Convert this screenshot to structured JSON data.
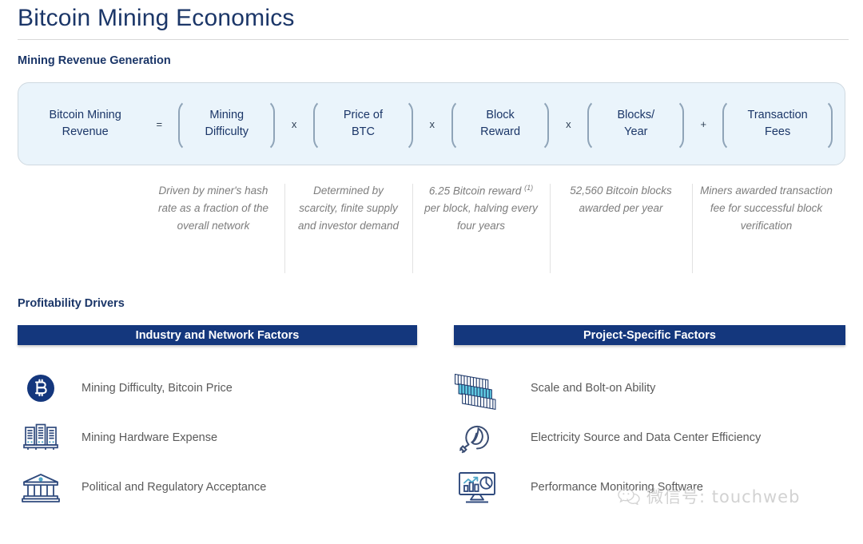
{
  "header": {
    "title": "Bitcoin Mining Economics"
  },
  "sections": {
    "revenue_label": "Mining Revenue Generation",
    "profitability_label": "Profitability Drivers"
  },
  "formula": {
    "result": "Bitcoin Mining\nRevenue",
    "equals": "=",
    "terms": [
      {
        "label": "Mining\nDifficulty",
        "operator_after": "x"
      },
      {
        "label": "Price of\nBTC",
        "operator_after": "x"
      },
      {
        "label": "Block\nReward",
        "operator_after": "x"
      },
      {
        "label": "Blocks/\nYear",
        "operator_after": "+"
      },
      {
        "label": "Transaction\nFees",
        "operator_after": ""
      }
    ],
    "box_fill": "#eaf4fb"
  },
  "captions": [
    "Driven by miner's hash rate as a fraction of the overall network",
    "Determined by scarcity, finite supply and investor demand",
    "6.25 Bitcoin reward (1) per block, halving every four years",
    "52,560 Bitcoin blocks awarded per year",
    "Miners awarded transaction fee for successful block verification"
  ],
  "caption_footnote_marker": "(1)",
  "drivers": {
    "left": {
      "banner": "Industry and Network Factors",
      "items": [
        {
          "icon": "bitcoin-coin-icon",
          "label": "Mining Difficulty, Bitcoin Price"
        },
        {
          "icon": "server-rack-icon",
          "label": "Mining Hardware Expense"
        },
        {
          "icon": "government-building-icon",
          "label": "Political and Regulatory Acceptance"
        }
      ]
    },
    "right": {
      "banner": "Project-Specific Factors",
      "items": [
        {
          "icon": "container-modules-icon",
          "label": "Scale and Bolt-on Ability"
        },
        {
          "icon": "power-plug-leaf-icon",
          "label": "Electricity Source and Data Center Efficiency"
        },
        {
          "icon": "monitor-analytics-icon",
          "label": "Performance Monitoring Software"
        }
      ]
    },
    "banner_color": "#14377d"
  },
  "watermark": {
    "icon": "wechat-bubble-icon",
    "text": "微信号: touchweb"
  },
  "colors": {
    "navy": "#1b3668",
    "banner_navy": "#14377d",
    "accent_cyan": "#3fb6d8",
    "body_gray": "#5a5a5a",
    "caption_gray": "#7d7d7d"
  }
}
